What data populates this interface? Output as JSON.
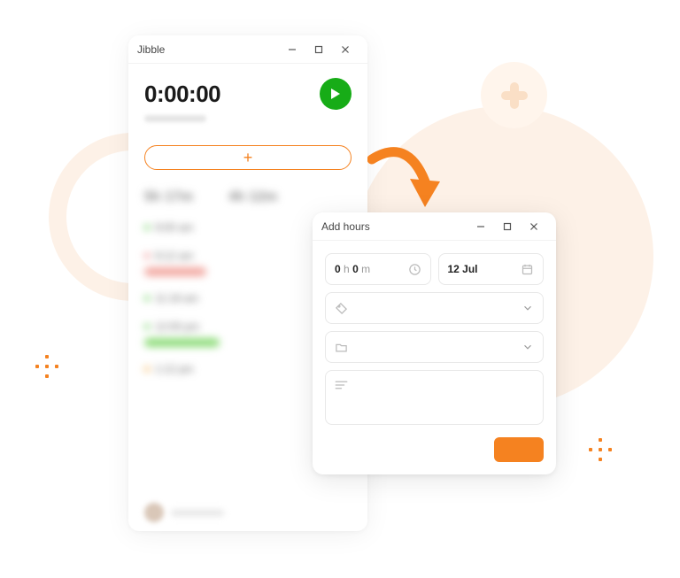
{
  "main_window": {
    "title": "Jibble",
    "timer": "0:00:00",
    "summary": [
      {
        "value": "5h 17m"
      },
      {
        "value": "4h 12m"
      }
    ],
    "entries": [
      {
        "time": "9:00 am",
        "dot": "green"
      },
      {
        "time": "9:12 am",
        "dot": "red",
        "bar": "red"
      },
      {
        "time": "11:18 am",
        "dot": "green"
      },
      {
        "time": "12:00 pm",
        "dot": "green",
        "bar": "green"
      },
      {
        "time": "1:12 pm",
        "dot": "orange"
      }
    ]
  },
  "modal": {
    "title": "Add hours",
    "duration": {
      "hours": "0",
      "h_label": "h",
      "minutes": "0",
      "m_label": "m"
    },
    "date": "12 Jul"
  }
}
